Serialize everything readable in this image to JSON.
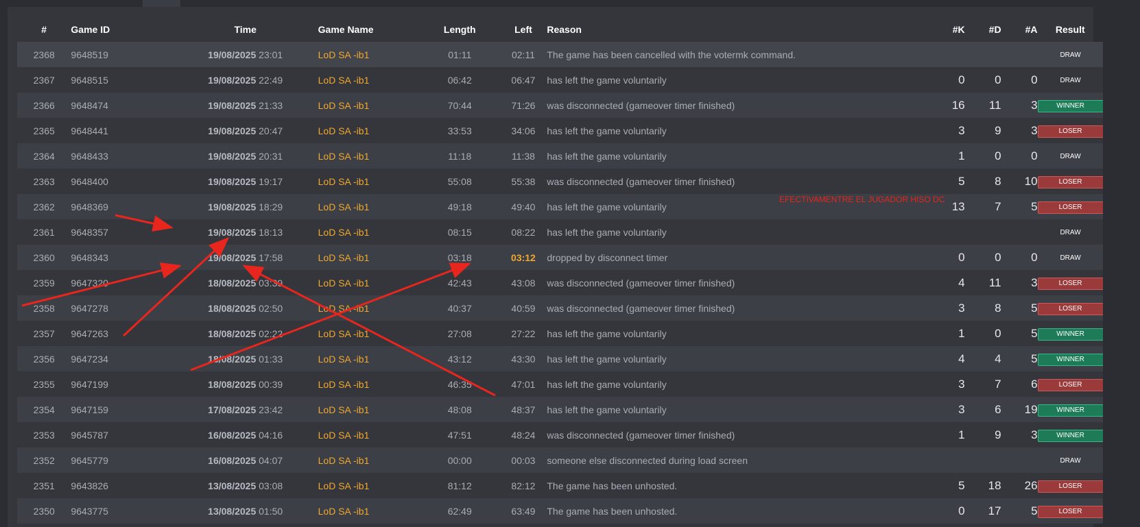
{
  "columns": {
    "num": "#",
    "game_id": "Game ID",
    "time": "Time",
    "game_name": "Game Name",
    "length": "Length",
    "left": "Left",
    "reason": "Reason",
    "k": "#K",
    "d": "#D",
    "a": "#A",
    "result": "Result"
  },
  "rows": [
    {
      "num": "2368",
      "id": "9648519",
      "date": "19/08/2025",
      "time": "23:01",
      "name": "LoD SA -ib1",
      "length": "01:11",
      "left": "02:11",
      "reason": "The game has been cancelled with the votermk command.",
      "k": "",
      "d": "",
      "a": "",
      "result": "DRAW"
    },
    {
      "num": "2367",
      "id": "9648515",
      "date": "19/08/2025",
      "time": "22:49",
      "name": "LoD SA -ib1",
      "length": "06:42",
      "left": "06:47",
      "reason": "has left the game voluntarily",
      "k": "0",
      "d": "0",
      "a": "0",
      "result": "DRAW"
    },
    {
      "num": "2366",
      "id": "9648474",
      "date": "19/08/2025",
      "time": "21:33",
      "name": "LoD SA -ib1",
      "length": "70:44",
      "left": "71:26",
      "reason": "was disconnected (gameover timer finished)",
      "k": "16",
      "d": "11",
      "a": "3",
      "result": "WINNER"
    },
    {
      "num": "2365",
      "id": "9648441",
      "date": "19/08/2025",
      "time": "20:47",
      "name": "LoD SA -ib1",
      "length": "33:53",
      "left": "34:06",
      "reason": "has left the game voluntarily",
      "k": "3",
      "d": "9",
      "a": "3",
      "result": "LOSER"
    },
    {
      "num": "2364",
      "id": "9648433",
      "date": "19/08/2025",
      "time": "20:31",
      "name": "LoD SA -ib1",
      "length": "11:18",
      "left": "11:38",
      "reason": "has left the game voluntarily",
      "k": "1",
      "d": "0",
      "a": "0",
      "result": "DRAW"
    },
    {
      "num": "2363",
      "id": "9648400",
      "date": "19/08/2025",
      "time": "19:17",
      "name": "LoD SA -ib1",
      "length": "55:08",
      "left": "55:38",
      "reason": "was disconnected (gameover timer finished)",
      "k": "5",
      "d": "8",
      "a": "10",
      "result": "LOSER"
    },
    {
      "num": "2362",
      "id": "9648369",
      "date": "19/08/2025",
      "time": "18:29",
      "name": "LoD SA -ib1",
      "length": "49:18",
      "left": "49:40",
      "reason": "has left the game voluntarily",
      "k": "13",
      "d": "7",
      "a": "5",
      "result": "LOSER"
    },
    {
      "num": "2361",
      "id": "9648357",
      "date": "19/08/2025",
      "time": "18:13",
      "name": "LoD SA -ib1",
      "length": "08:15",
      "left": "08:22",
      "reason": "has left the game voluntarily",
      "k": "",
      "d": "",
      "a": "",
      "result": "DRAW"
    },
    {
      "num": "2360",
      "id": "9648343",
      "date": "19/08/2025",
      "time": "17:58",
      "name": "LoD SA -ib1",
      "length": "03:18",
      "left": "03:12",
      "reason": "dropped by disconnect timer",
      "k": "0",
      "d": "0",
      "a": "0",
      "result": "DRAW",
      "left_highlight": true
    },
    {
      "num": "2359",
      "id": "9647320",
      "date": "18/08/2025",
      "time": "03:39",
      "name": "LoD SA -ib1",
      "length": "42:43",
      "left": "43:08",
      "reason": "was disconnected (gameover timer finished)",
      "k": "4",
      "d": "11",
      "a": "3",
      "result": "LOSER"
    },
    {
      "num": "2358",
      "id": "9647278",
      "date": "18/08/2025",
      "time": "02:50",
      "name": "LoD SA -ib1",
      "length": "40:37",
      "left": "40:59",
      "reason": "was disconnected (gameover timer finished)",
      "k": "3",
      "d": "8",
      "a": "5",
      "result": "LOSER"
    },
    {
      "num": "2357",
      "id": "9647263",
      "date": "18/08/2025",
      "time": "02:22",
      "name": "LoD SA -ib1",
      "length": "27:08",
      "left": "27:22",
      "reason": "has left the game voluntarily",
      "k": "1",
      "d": "0",
      "a": "5",
      "result": "WINNER"
    },
    {
      "num": "2356",
      "id": "9647234",
      "date": "18/08/2025",
      "time": "01:33",
      "name": "LoD SA -ib1",
      "length": "43:12",
      "left": "43:30",
      "reason": "has left the game voluntarily",
      "k": "4",
      "d": "4",
      "a": "5",
      "result": "WINNER"
    },
    {
      "num": "2355",
      "id": "9647199",
      "date": "18/08/2025",
      "time": "00:39",
      "name": "LoD SA -ib1",
      "length": "46:35",
      "left": "47:01",
      "reason": "has left the game voluntarily",
      "k": "3",
      "d": "7",
      "a": "6",
      "result": "LOSER"
    },
    {
      "num": "2354",
      "id": "9647159",
      "date": "17/08/2025",
      "time": "23:42",
      "name": "LoD SA -ib1",
      "length": "48:08",
      "left": "48:37",
      "reason": "has left the game voluntarily",
      "k": "3",
      "d": "6",
      "a": "19",
      "result": "WINNER"
    },
    {
      "num": "2353",
      "id": "9645787",
      "date": "16/08/2025",
      "time": "04:16",
      "name": "LoD SA -ib1",
      "length": "47:51",
      "left": "48:24",
      "reason": "was disconnected (gameover timer finished)",
      "k": "1",
      "d": "9",
      "a": "3",
      "result": "WINNER"
    },
    {
      "num": "2352",
      "id": "9645779",
      "date": "16/08/2025",
      "time": "04:07",
      "name": "LoD SA -ib1",
      "length": "00:00",
      "left": "00:03",
      "reason": "someone else disconnected during load screen",
      "k": "",
      "d": "",
      "a": "",
      "result": "DRAW"
    },
    {
      "num": "2351",
      "id": "9643826",
      "date": "13/08/2025",
      "time": "03:08",
      "name": "LoD SA -ib1",
      "length": "81:12",
      "left": "82:12",
      "reason": "The game has been unhosted.",
      "k": "5",
      "d": "18",
      "a": "26",
      "result": "LOSER"
    },
    {
      "num": "2350",
      "id": "9643775",
      "date": "13/08/2025",
      "time": "01:50",
      "name": "LoD SA -ib1",
      "length": "62:49",
      "left": "63:49",
      "reason": "The game has been unhosted.",
      "k": "0",
      "d": "17",
      "a": "5",
      "result": "LOSER"
    }
  ],
  "annotation": {
    "text": "EFECTIVAMENTRE EL JUGADOR HISO DC",
    "color": "#e8261d"
  },
  "colors": {
    "game_name": "#f0a830",
    "winner": "#1d7b58",
    "loser": "#9b3a3a",
    "arrow": "#e8261d"
  }
}
